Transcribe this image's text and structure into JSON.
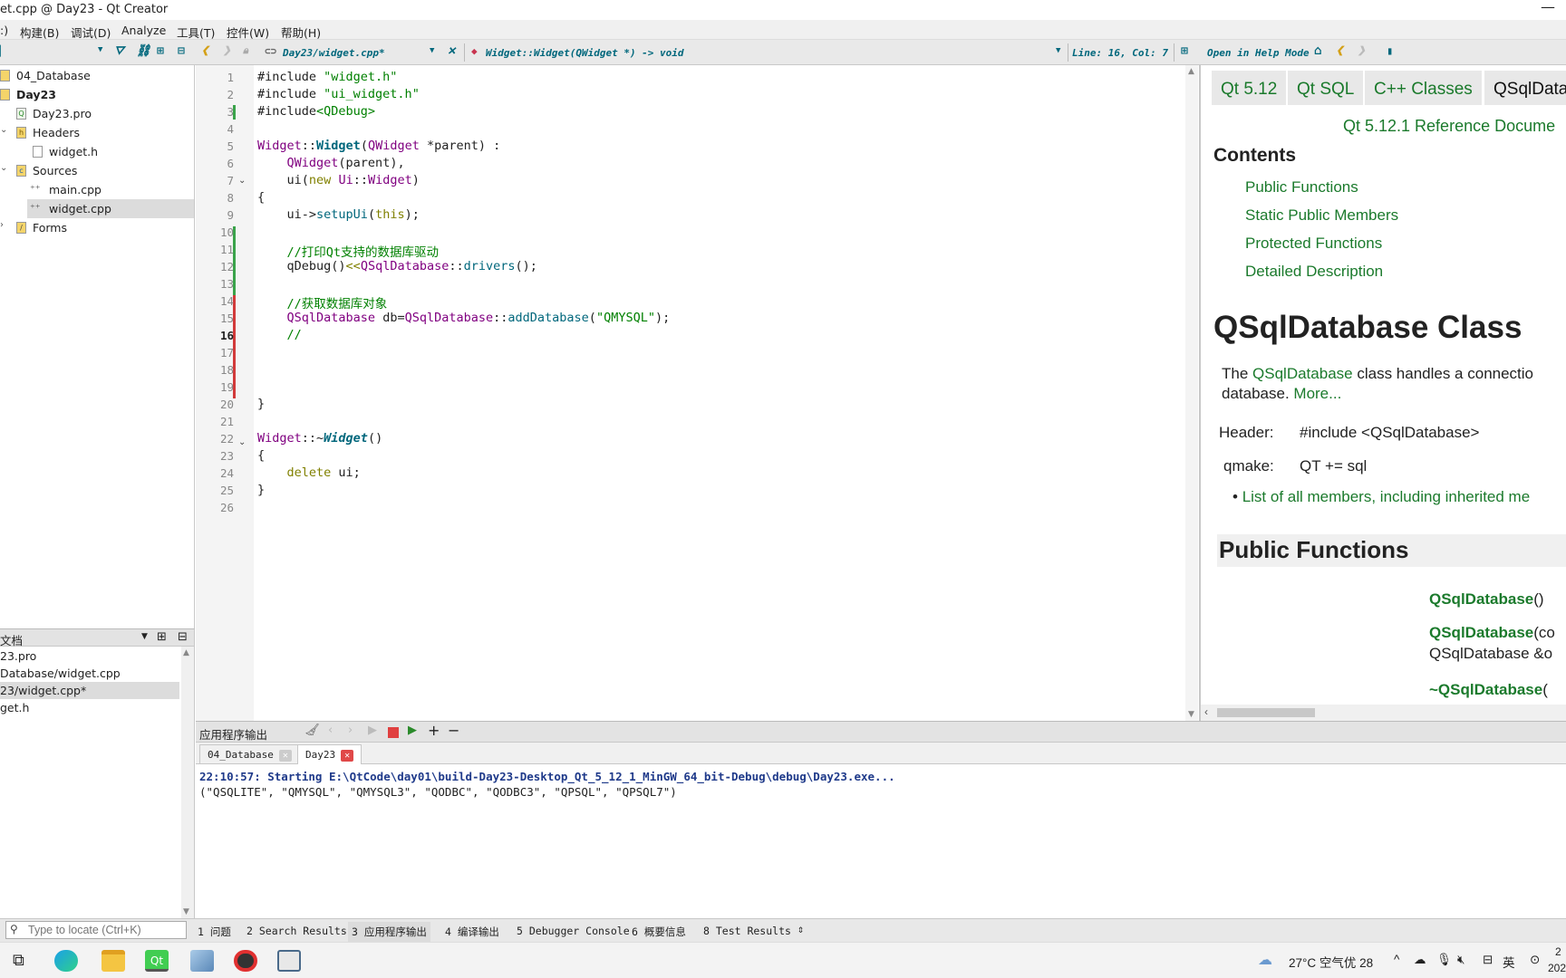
{
  "window": {
    "title": "et.cpp @ Day23 - Qt Creator",
    "minimize": "—"
  },
  "menu": [
    ":)",
    "构建(B)",
    "调试(D)",
    "Analyze",
    "工具(T)",
    "控件(W)",
    "帮助(H)"
  ],
  "toolbar": {
    "file_combo": "Day23/widget.cpp*",
    "symbol_combo": "Widget::Widget(QWidget *) -> void",
    "position": "Line: 16, Col: 7",
    "help_mode": "Open in Help Mode"
  },
  "project_tree": [
    {
      "label": "04_Database",
      "indent": 0,
      "bold": false
    },
    {
      "label": "Day23",
      "indent": 0,
      "bold": true
    },
    {
      "label": "Day23.pro",
      "indent": 1
    },
    {
      "label": "Headers",
      "indent": 1
    },
    {
      "label": "widget.h",
      "indent": 2
    },
    {
      "label": "Sources",
      "indent": 1
    },
    {
      "label": "main.cpp",
      "indent": 2
    },
    {
      "label": "widget.cpp",
      "indent": 2
    },
    {
      "label": "Forms",
      "indent": 1
    }
  ],
  "open_docs": {
    "title": "文档",
    "items": [
      "23.pro",
      "Database/widget.cpp",
      "23/widget.cpp*",
      "get.h"
    ]
  },
  "code_lines": [
    "1",
    "2",
    "3",
    "4",
    "5",
    "6",
    "7",
    "8",
    "9",
    "10",
    "11",
    "12",
    "13",
    "14",
    "15",
    "16",
    "17",
    "18",
    "19",
    "20",
    "21",
    "22",
    "23",
    "24",
    "25",
    "26"
  ],
  "code": {
    "l1a": "#include ",
    "l1b": "\"widget.h\"",
    "l2a": "#include ",
    "l2b": "\"ui_widget.h\"",
    "l3a": "#include",
    "l3b": "<QDebug>",
    "l5a": "Widget",
    "l5b": "::",
    "l5c": "Widget",
    "l5d": "(",
    "l5e": "QWidget",
    "l5f": " *parent) :",
    "l6a": "    ",
    "l6b": "QWidget",
    "l6c": "(parent),",
    "l7a": "    ui(",
    "l7b": "new",
    "l7c": " ",
    "l7d": "Ui",
    "l7e": "::",
    "l7f": "Widget",
    "l7g": ")",
    "l8": "{",
    "l9a": "    ui->",
    "l9b": "setupUi",
    "l9c": "(",
    "l9d": "this",
    "l9e": ");",
    "l11": "    //打印Qt支持的数据库驱动",
    "l12a": "    qDebug()",
    "l12b": "<<",
    "l12c": "QSqlDatabase",
    "l12d": "::",
    "l12e": "drivers",
    "l12f": "();",
    "l14": "    //获取数据库对象",
    "l15a": "    ",
    "l15b": "QSqlDatabase",
    "l15c": " db=",
    "l15d": "QSqlDatabase",
    "l15e": "::",
    "l15f": "addDatabase",
    "l15g": "(",
    "l15h": "\"QMYSQL\"",
    "l15i": ");",
    "l16": "    //",
    "l20": "}",
    "l22a": "Widget",
    "l22b": "::~",
    "l22c": "Widget",
    "l22d": "()",
    "l23": "{",
    "l24a": "    ",
    "l24b": "delete",
    "l24c": " ui;",
    "l25": "}"
  },
  "help": {
    "crumbs": [
      "Qt 5.12",
      "Qt SQL",
      "C++ Classes",
      "QSqlData"
    ],
    "ref": "Qt 5.12.1 Reference Docume",
    "contents_title": "Contents",
    "contents": [
      "Public Functions",
      "Static Public Members",
      "Protected Functions",
      "Detailed Description"
    ],
    "class_title": "QSqlDatabase Class",
    "desc_a": "The ",
    "desc_link": "QSqlDatabase",
    "desc_b": " class handles a connectio",
    "desc_c": "database. ",
    "more": "More...",
    "header_label": "Header:",
    "header_value": "#include <QSqlDatabase>",
    "qmake_label": "qmake:",
    "qmake_value": "QT += sql",
    "members_link": "List of all members, including inherited me",
    "pf_title": "Public Functions",
    "pf1": "QSqlDatabase",
    "pf1b": "()",
    "pf2": "QSqlDatabase",
    "pf2b": "(co",
    "pf2c": "QSqlDatabase &o",
    "pf3": "~QSqlDatabase",
    "pf3b": "("
  },
  "output_pane": {
    "title": "应用程序输出",
    "tabs": [
      "04_Database",
      "Day23"
    ],
    "line1": "22:10:57: Starting E:\\QtCode\\day01\\build-Day23-Desktop_Qt_5_12_1_MinGW_64_bit-Debug\\debug\\Day23.exe...",
    "line2": "(\"QSQLITE\", \"QMYSQL\", \"QMYSQL3\", \"QODBC\", \"QODBC3\", \"QPSQL\", \"QPSQL7\")"
  },
  "statusbar": {
    "locate_placeholder": "Type to locate (Ctrl+K)",
    "panes": [
      "1 问题",
      "2 Search Results",
      "3 应用程序输出",
      "4 编译输出",
      "5 Debugger Console",
      "6 概要信息",
      "8 Test Results"
    ]
  },
  "taskbar": {
    "weather": "27°C 空气优 28",
    "ime": "英",
    "clock_a": "2",
    "clock_b": "202"
  }
}
